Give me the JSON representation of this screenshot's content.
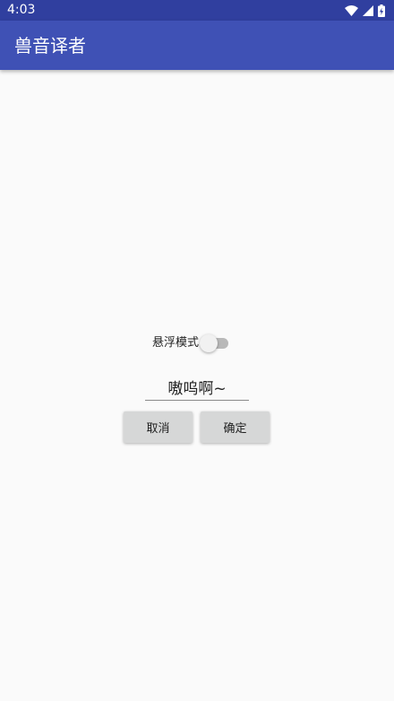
{
  "status_bar": {
    "time": "4:03",
    "icons": [
      "wifi-icon",
      "cell-signal-icon",
      "battery-charging-icon"
    ]
  },
  "app_bar": {
    "title": "兽音译者"
  },
  "float_mode": {
    "label": "悬浮模式",
    "enabled": false
  },
  "input": {
    "value": "嗷呜啊~"
  },
  "buttons": {
    "cancel_label": "取消",
    "ok_label": "确定"
  },
  "colors": {
    "primary": "#3F51B5",
    "primary_dark": "#303F9F",
    "background": "#FAFAFA",
    "button": "#D6D7D7"
  }
}
